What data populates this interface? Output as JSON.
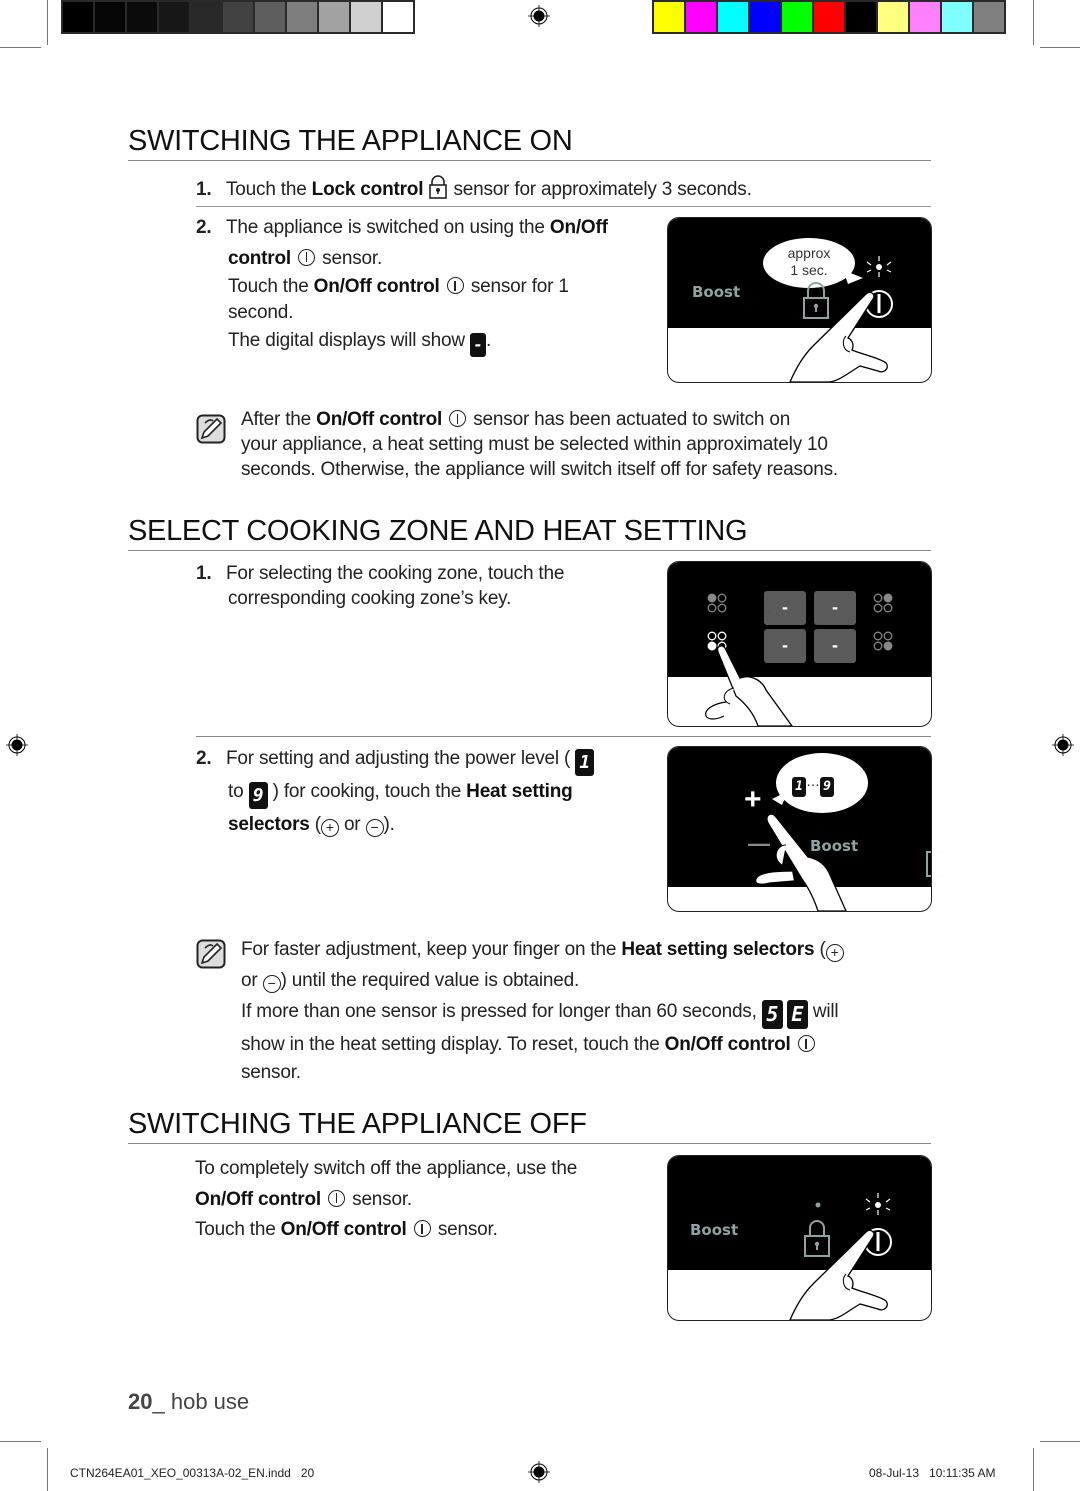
{
  "colorbars": {
    "grayscale": [
      "#000000",
      "#050505",
      "#0b0b0b",
      "#171717",
      "#282828",
      "#414141",
      "#5e5e5e",
      "#7e7e7e",
      "#a2a2a2",
      "#d0d0d0",
      "#ffffff"
    ],
    "process": [
      "#ffff00",
      "#ff00ff",
      "#00ffff",
      "#0000ff",
      "#00ff00",
      "#ff0000",
      "#000000",
      "#ffff80",
      "#ff80ff",
      "#80ffff",
      "#808080"
    ]
  },
  "section_on": {
    "title": "SWITCHING THE APPLIANCE ON",
    "step1": {
      "num": "1.",
      "pre": "Touch the ",
      "bold": "Lock control",
      "post": " sensor for approximately 3 seconds."
    },
    "step2": {
      "num": "2.",
      "line1_pre": "The appliance is switched on using the ",
      "line1_bold": "On/Off",
      "line2_bold": "control",
      "line2_post": " sensor.",
      "line3_pre": "Touch the ",
      "line3_bold": "On/Off control",
      "line3_post": " sensor for 1",
      "line4": "second.",
      "line5_pre": "The digital displays will show ",
      "line5_display": "-",
      "line5_post": "."
    },
    "illustration": {
      "bubble_line1": "approx",
      "bubble_line2": "1 sec.",
      "boost_label": "Boost"
    },
    "note": {
      "line1_pre": "After the ",
      "line1_bold": "On/Off control",
      "line1_post": " sensor has been actuated to switch on",
      "line2": "your appliance, a heat setting must be selected within approximately 10",
      "line3": "seconds. Otherwise, the appliance will switch itself off for safety reasons."
    }
  },
  "section_select": {
    "title": "SELECT COOKING ZONE AND HEAT SETTING",
    "step1": {
      "num": "1.",
      "line1": "For selecting the cooking zone, touch the",
      "line2": "corresponding cooking zone’s key."
    },
    "illustration1": {
      "displays": [
        "-",
        "-",
        "-",
        "-"
      ]
    },
    "step2": {
      "num": "2.",
      "line1": "For setting and adjusting the power level ( ",
      "min_display": "1",
      "line2_pre": "to ",
      "max_display": "9",
      "line2_mid": " ) for cooking, touch the ",
      "line2_bold": "Heat setting",
      "line3_bold": "selectors",
      "plus": "+",
      "or": " or ",
      "minus": "−",
      "line3_post": "."
    },
    "illustration2": {
      "range_min": "1",
      "range_sep": "…",
      "range_max": "9",
      "plus": "+",
      "minus": "—",
      "boost_label": "Boost"
    },
    "note": {
      "line1_pre": "For faster adjustment, keep your finger on the ",
      "line1_bold": "Heat setting selectors",
      "plus": "+",
      "line2_pre": "or ",
      "minus": "−",
      "line2_post": ") until the required value is obtained.",
      "line3_pre": "If more than one sensor is pressed for longer than 60 seconds, ",
      "err1": "5",
      "err2": "E",
      "line3_post": " will",
      "line4_pre": "show in the heat setting display. To reset, touch the ",
      "line4_bold": "On/Off control",
      "line5": "sensor."
    }
  },
  "section_off": {
    "title": "SWITCHING THE APPLIANCE OFF",
    "line1": "To completely switch off the appliance, use the",
    "line2_bold": "On/Off control",
    "line2_post": " sensor.",
    "line3_pre": "Touch the ",
    "line3_bold": "On/Off control",
    "line3_post": " sensor.",
    "illustration": {
      "boost_label": "Boost"
    }
  },
  "footer": {
    "page_num": "20",
    "page_sep": "_ ",
    "page_section": "hob use",
    "file_slug": "CTN264EA01_XEO_00313A-02_EN.indd   20",
    "timestamp": "08-Jul-13   10:11:35 AM"
  }
}
